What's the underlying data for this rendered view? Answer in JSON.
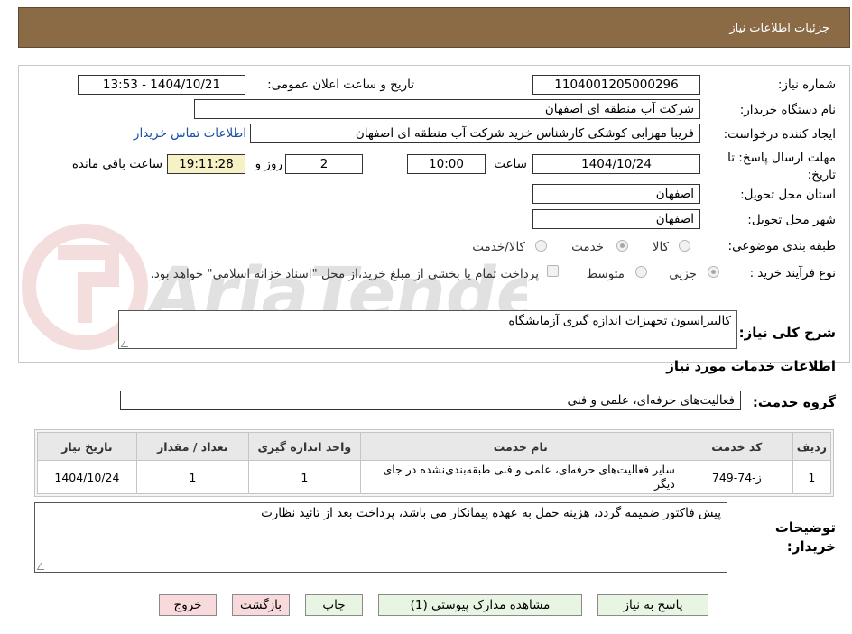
{
  "header": {
    "title": "جزئیات اطلاعات نیاز"
  },
  "fields": {
    "need_number_label": "شماره نیاز:",
    "need_number": "1104001205000296",
    "announce_label": "تاریخ و ساعت اعلان عمومی:",
    "announce_value": "1404/10/21 - 13:53",
    "buyer_org_label": "نام دستگاه خریدار:",
    "buyer_org": "شرکت آب منطقه ای اصفهان",
    "requester_label": "ایجاد کننده درخواست:",
    "requester": "فریبا مهرابی کوشکی کارشناس خرید شرکت آب منطقه ای اصفهان",
    "buyer_contact_link": "اطلاعات تماس خریدار",
    "deadline_label": "مهلت ارسال پاسخ: تا تاریخ:",
    "deadline_date": "1404/10/24",
    "time_label": "ساعت",
    "deadline_time": "10:00",
    "days_value": "2",
    "days_label": "روز و",
    "remaining_time": "19:11:28",
    "remaining_label": "ساعت باقی مانده",
    "province_label": "استان محل تحویل:",
    "province": "اصفهان",
    "city_label": "شهر محل تحویل:",
    "city": "اصفهان",
    "category_label": "طبقه بندی موضوعی:",
    "category_options": [
      "کالا",
      "خدمت",
      "کالا/خدمت"
    ],
    "purchase_type_label": "نوع فرآیند خرید :",
    "purchase_options": [
      "جزیی",
      "متوسط"
    ],
    "purchase_note": "پرداخت تمام یا بخشی از مبلغ خرید،از محل \"اسناد خزانه اسلامی\" خواهد بود.",
    "description_label": "شرح کلی نیاز:",
    "description": "کالیبراسیون تجهیزات اندازه گیری آزمایشگاه",
    "services_title": "اطلاعات خدمات مورد نیاز",
    "service_group_label": "گروه خدمت:",
    "service_group": "فعالیت‌های حرفه‌ای، علمی و فنی",
    "buyer_notes_label_1": "توضیحات",
    "buyer_notes_label_2": "خریدار:",
    "buyer_notes": "پیش فاکتور ضمیمه گردد، هزینه حمل به عهده پیمانکار می باشد، پرداخت بعد از تائید نظارت"
  },
  "table": {
    "headers": [
      "ردیف",
      "کد خدمت",
      "نام خدمت",
      "واحد اندازه گیری",
      "تعداد / مقدار",
      "تاریخ نیاز"
    ],
    "rows": [
      [
        "1",
        "ز-74-749",
        "سایر فعالیت‌های حرفه‌ای، علمی و فنی طبقه‌بندی‌نشده در جای دیگر",
        "1",
        "1",
        "1404/10/24"
      ]
    ]
  },
  "buttons": {
    "reply": "پاسخ به نیاز",
    "attachments": "مشاهده مدارک پیوستی (1)",
    "print": "چاپ",
    "back": "بازگشت",
    "exit": "خروج"
  },
  "colors": {
    "header_bg": "#8b6b45",
    "button_green": "#e9f5e3",
    "button_red": "#f8d9dc",
    "link": "#1a4ea8",
    "remaining_bg": "#f7f2c6"
  },
  "watermark": "AriaTender.neT"
}
